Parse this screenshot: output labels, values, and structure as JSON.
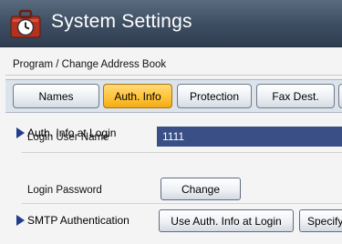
{
  "window": {
    "title": "System Settings",
    "icon": "settings-toolbox-clock-icon"
  },
  "breadcrumb": "Program / Change Address Book",
  "tabs": [
    {
      "label": "Names",
      "active": false
    },
    {
      "label": "Auth. Info",
      "active": true
    },
    {
      "label": "Protection",
      "active": false
    },
    {
      "label": "Fax Dest.",
      "active": false
    }
  ],
  "auth_info_at_login": {
    "header": "Auth. Info at Login",
    "login_user_name_label": "Login User Name",
    "login_user_name_value": "1111",
    "login_password_label": "Login Password",
    "change_button": "Change"
  },
  "smtp_authentication": {
    "header": "SMTP Authentication",
    "use_auth_button": "Use Auth. Info at Login",
    "specify_button": "Specify"
  },
  "colors": {
    "titlebar": "#3f4f63",
    "active_tab": "#ffc43a",
    "value_field": "#3a4f86",
    "arrow": "#1f3d8a"
  }
}
